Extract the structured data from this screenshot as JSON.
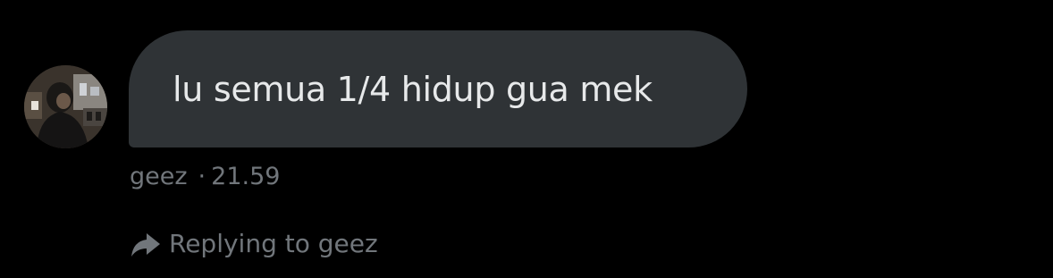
{
  "message": {
    "text": "lu semua 1/4 hidup gua mek",
    "sender": "geez",
    "separator": "·",
    "time": "21.59"
  },
  "reply_context": {
    "icon": "reply-arrow-icon",
    "text": "Replying to geez"
  },
  "avatar": {
    "icon": "user-avatar-photo"
  },
  "colors": {
    "background": "#000000",
    "bubble": "#2f3336",
    "bubble_text": "#e7e9ea",
    "secondary_text": "#71767b"
  }
}
